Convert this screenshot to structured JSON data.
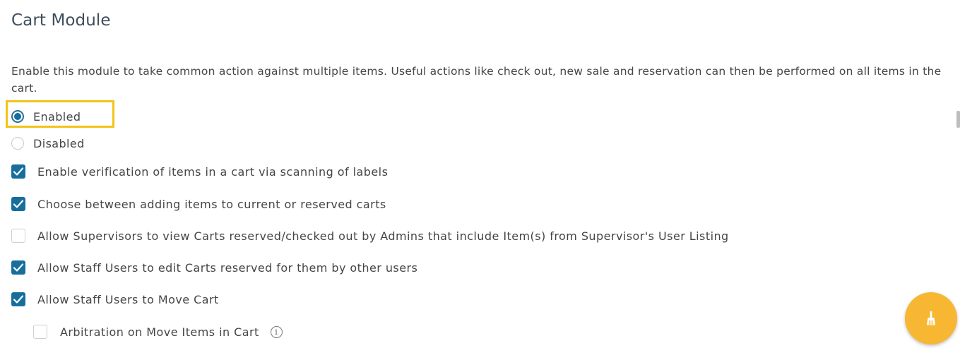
{
  "section": {
    "title": "Cart Module",
    "description": "Enable this module to take common action against multiple items. Useful actions like check out, new sale and reservation can then be performed on all items in the cart."
  },
  "module_status": {
    "selected": "Enabled",
    "options": [
      {
        "label": "Enabled",
        "checked": true
      },
      {
        "label": "Disabled",
        "checked": false
      }
    ]
  },
  "settings": [
    {
      "label": "Enable verification of items in a cart via scanning of labels",
      "checked": true
    },
    {
      "label": "Choose between adding items to current or reserved carts",
      "checked": true
    },
    {
      "label": "Allow Supervisors to view Carts reserved/checked out by Admins that include Item(s) from Supervisor's User Listing",
      "checked": false
    },
    {
      "label": "Allow Staff Users to edit Carts reserved for them by other users",
      "checked": true
    },
    {
      "label": "Allow Staff Users to Move Cart",
      "checked": true
    },
    {
      "label": "Arbitration on Move Items in Cart",
      "checked": false
    }
  ],
  "icons": {
    "info": "info-icon",
    "fab": "broom-icon"
  },
  "colors": {
    "accent": "#176e9d",
    "highlight": "#f2c416",
    "fab": "#f7b733"
  }
}
